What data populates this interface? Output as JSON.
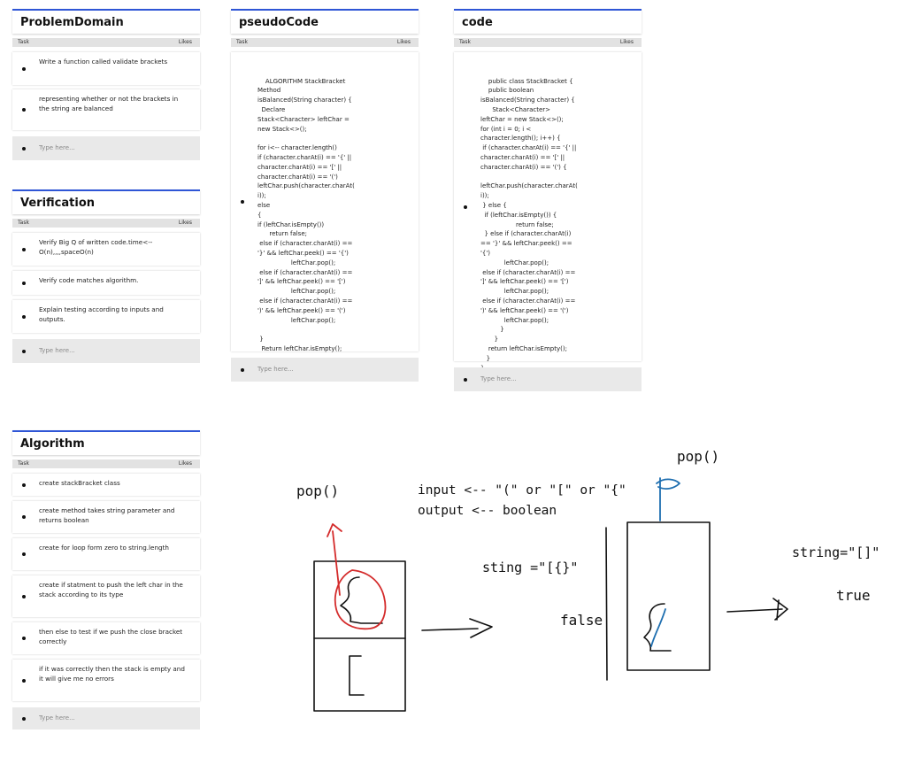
{
  "columns": {
    "task": "Task",
    "likes": "Likes"
  },
  "input_placeholder": "Type here...",
  "problem_domain": {
    "title": "ProblemDomain",
    "items": [
      "Write a function called validate brackets",
      "representing whether or not the brackets in the string are balanced"
    ]
  },
  "verification": {
    "title": "Verification",
    "items": [
      "Verify Big Q of written code.time<--O(n),,,,spaceO(n)",
      "Verify code matches algorithm.",
      "Explain testing according to inputs and outputs."
    ]
  },
  "pseudo_code": {
    "title": "pseudoCode",
    "code": "ALGORITHM StackBracket\nMethod\nisBalanced(String character) {\n  Declare\nStack<Character> leftChar =\nnew Stack<>();\n\nfor i<-- character.length()\nif (character.charAt(i) == '{' ||\ncharacter.charAt(i) == '[' ||\ncharacter.charAt(i) == '(')\nleftChar.push(character.charAt(\ni));\nelse\n{\nif (leftChar.isEmpty())\n      return false;\n else if (character.charAt(i) ==\n'}' && leftChar.peek() == '{')\n                 leftChar.pop();\n else if (character.charAt(i) ==\n']' && leftChar.peek() == '[')\n                 leftChar.pop();\n else if (character.charAt(i) ==\n')' && leftChar.peek() == '(')\n                 leftChar.pop();\n\n }\n  Return leftChar.isEmpty();"
  },
  "code_card": {
    "title": "code",
    "code": "public class StackBracket {\n    public boolean\nisBalanced(String character) {\n      Stack<Character>\nleftChar = new Stack<>();\nfor (int i = 0; i <\ncharacter.length(); i++) {\n if (character.charAt(i) == '{' ||\ncharacter.charAt(i) == '[' ||\ncharacter.charAt(i) == '(') {\n\nleftChar.push(character.charAt(\ni));\n } else {\n  if (leftChar.isEmpty()) {\n                  return false;\n  } else if (character.charAt(i)\n== '}' && leftChar.peek() ==\n'{')\n            leftChar.pop();\n else if (character.charAt(i) ==\n']' && leftChar.peek() == '[')\n            leftChar.pop();\n else if (character.charAt(i) ==\n')' && leftChar.peek() == '(')\n            leftChar.pop();\n          }\n       }\n    return leftChar.isEmpty();\n   }\n}"
  },
  "algorithm": {
    "title": "Algorithm",
    "items": [
      "create stackBracket class",
      "create method takes string parameter and returns boolean",
      "create for loop form zero to string.length",
      "create if statment to push the left char in the stack according to its type",
      "then else to test if we push the close bracket correctly",
      "if it was correctly then the stack is empty and it will give me no errors"
    ]
  },
  "sketch": {
    "pop_left": "pop()",
    "pop_right": "pop()",
    "input_line": "input <-- \"(\" or \"[\" or \"{\"",
    "output_line": "output <-- boolean",
    "sting_label": "sting =\"[{}\"",
    "false_label": "false",
    "string_label": "string=\"[]\"",
    "true_label": "true",
    "red_color": "#d42b2b",
    "blue_color": "#1f6fb0"
  }
}
